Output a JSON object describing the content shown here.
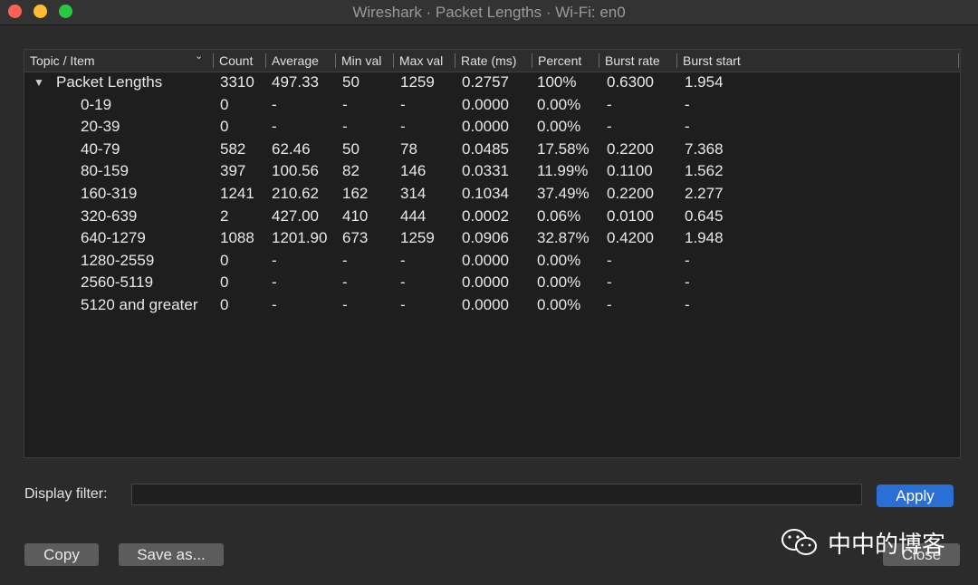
{
  "window": {
    "title": "Wireshark · Packet Lengths · Wi-Fi: en0"
  },
  "table": {
    "headers": [
      "Topic / Item",
      "Count",
      "Average",
      "Min val",
      "Max val",
      "Rate (ms)",
      "Percent",
      "Burst rate",
      "Burst start"
    ],
    "rows": [
      [
        "Packet Lengths",
        "3310",
        "497.33",
        "50",
        "1259",
        "0.2757",
        "100%",
        "0.6300",
        "1.954"
      ],
      [
        "0-19",
        "0",
        "-",
        "-",
        "-",
        "0.0000",
        "0.00%",
        "-",
        "-"
      ],
      [
        "20-39",
        "0",
        "-",
        "-",
        "-",
        "0.0000",
        "0.00%",
        "-",
        "-"
      ],
      [
        "40-79",
        "582",
        "62.46",
        "50",
        "78",
        "0.0485",
        "17.58%",
        "0.2200",
        "7.368"
      ],
      [
        "80-159",
        "397",
        "100.56",
        "82",
        "146",
        "0.0331",
        "11.99%",
        "0.1100",
        "1.562"
      ],
      [
        "160-319",
        "1241",
        "210.62",
        "162",
        "314",
        "0.1034",
        "37.49%",
        "0.2200",
        "2.277"
      ],
      [
        "320-639",
        "2",
        "427.00",
        "410",
        "444",
        "0.0002",
        "0.06%",
        "0.0100",
        "0.645"
      ],
      [
        "640-1279",
        "1088",
        "1201.90",
        "673",
        "1259",
        "0.0906",
        "32.87%",
        "0.4200",
        "1.948"
      ],
      [
        "1280-2559",
        "0",
        "-",
        "-",
        "-",
        "0.0000",
        "0.00%",
        "-",
        "-"
      ],
      [
        "2560-5119",
        "0",
        "-",
        "-",
        "-",
        "0.0000",
        "0.00%",
        "-",
        "-"
      ],
      [
        "5120 and greater",
        "0",
        "-",
        "-",
        "-",
        "0.0000",
        "0.00%",
        "-",
        "-"
      ]
    ]
  },
  "filter": {
    "label": "Display filter:",
    "value": "",
    "apply_label": "Apply"
  },
  "buttons": {
    "copy": "Copy",
    "save_as": "Save as...",
    "close": "Close"
  },
  "watermark": {
    "text": "中中的博客"
  },
  "colors": {
    "apply_blue": "#2a6fd6",
    "close_red": "#fe5f57",
    "minimize_yellow": "#febc2e",
    "zoom_green": "#28c840"
  }
}
